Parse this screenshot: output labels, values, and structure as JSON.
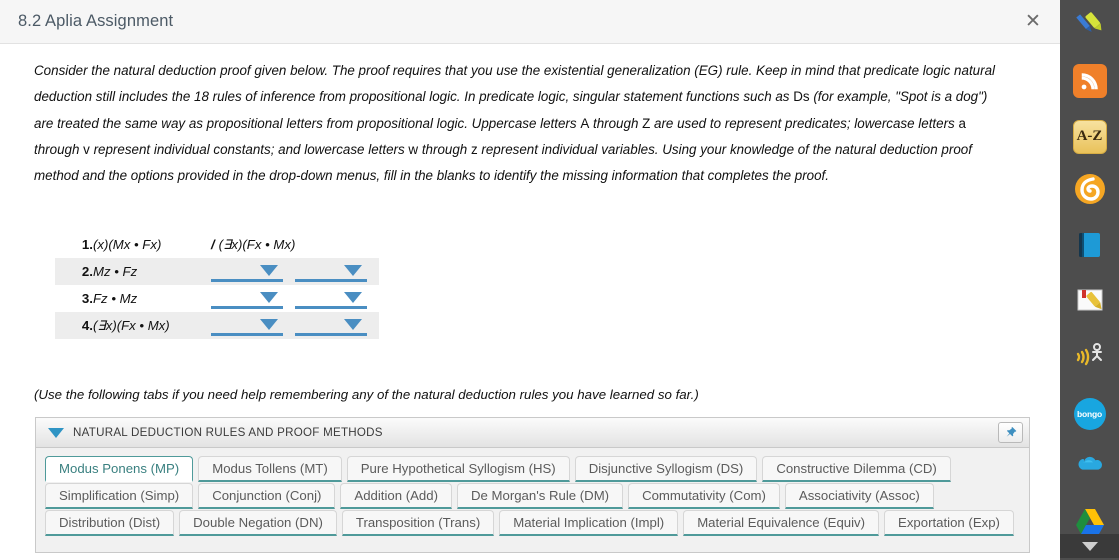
{
  "window": {
    "title": "8.2 Aplia Assignment",
    "close_label": "✕"
  },
  "intro": {
    "line1_a": "Consider the natural deduction proof given below. The proof requires that you use the existential generalization (EG) rule. Keep in mind that predicate",
    "line2_a": "logic natural deduction still includes the 18 rules of inference from propositional logic. In predicate logic, singular statement functions such as ",
    "line2_rm": "Ds",
    "line2_b": " (for",
    "line3_a": "example, \"Spot is a dog\") are treated the same way as propositional letters from propositional logic. Uppercase letters ",
    "line3_rm": "A",
    "line3_b": " through ",
    "line3_rm2": "Z",
    "line3_c": " are used to",
    "line4_a": "represent predicates; lowercase letters ",
    "line4_rm": "a",
    "line4_b": " through ",
    "line4_rm2": "v",
    "line4_c": " represent individual constants; and lowercase letters ",
    "line4_rm3": "w",
    "line4_d": " through ",
    "line4_rm4": "z",
    "line4_e": " represent individual variables.",
    "line5_a": "Using your knowledge of the natural deduction proof method and the options provided in the drop-down menus, fill in the blanks to identify the",
    "line6_a": "missing information that completes the proof."
  },
  "proof": {
    "rows": [
      {
        "num": "1.",
        "wff": "(x)(Mx • Fx)",
        "conclusion_slash": "/",
        "conclusion": "(∃x)(Fx • Mx)",
        "has_dropdowns": false
      },
      {
        "num": "2.",
        "wff": "Mz • Fz",
        "conclusion_slash": "",
        "conclusion": "",
        "has_dropdowns": true
      },
      {
        "num": "3.",
        "wff": "Fz • Mz",
        "conclusion_slash": "",
        "conclusion": "",
        "has_dropdowns": true
      },
      {
        "num": "4.",
        "wff": "(∃x)(Fx • Mx)",
        "conclusion_slash": "",
        "conclusion": "",
        "has_dropdowns": true
      }
    ]
  },
  "hint": {
    "text": "(Use the following tabs if you need help remembering any of the natural deduction rules you have learned so far.)"
  },
  "panel": {
    "header_label": "NATURAL DEDUCTION RULES AND PROOF METHODS",
    "caret_icon": "caret-down-icon",
    "pin_icon": "📌",
    "tab_rows": [
      [
        {
          "label": "Modus Ponens (MP)",
          "active": true
        },
        {
          "label": "Modus Tollens (MT)",
          "active": false
        },
        {
          "label": "Pure Hypothetical Syllogism (HS)",
          "active": false
        },
        {
          "label": "Disjunctive Syllogism (DS)",
          "active": false
        },
        {
          "label": "Constructive Dilemma (CD)",
          "active": false
        }
      ],
      [
        {
          "label": "Simplification (Simp)",
          "active": false
        },
        {
          "label": "Conjunction (Conj)",
          "active": false
        },
        {
          "label": "Addition (Add)",
          "active": false
        },
        {
          "label": "De Morgan's Rule (DM)",
          "active": false
        },
        {
          "label": "Commutativity (Com)",
          "active": false
        },
        {
          "label": "Associativity (Assoc)",
          "active": false
        }
      ],
      [
        {
          "label": "Distribution (Dist)",
          "active": false
        },
        {
          "label": "Double Negation (DN)",
          "active": false
        },
        {
          "label": "Transposition (Trans)",
          "active": false
        },
        {
          "label": "Material Implication (Impl)",
          "active": false
        },
        {
          "label": "Material Equivalence (Equiv)",
          "active": false
        },
        {
          "label": "Exportation (Exp)",
          "active": false
        }
      ]
    ]
  },
  "sidebar": {
    "background": "#4d4d4d",
    "items": [
      {
        "name": "highlighter-pen-icon",
        "type": "pen"
      },
      {
        "name": "rss-feed-icon",
        "type": "rss",
        "color": "#f0802a"
      },
      {
        "name": "dictionary-az-icon",
        "type": "az",
        "label": "A-Z",
        "color": "#f2d071"
      },
      {
        "name": "blackboard-icon",
        "type": "swirl",
        "color": "#f5a623"
      },
      {
        "name": "ebook-icon",
        "type": "book",
        "color": "#1e9ad6"
      },
      {
        "name": "notes-highlight-icon",
        "type": "notes",
        "color": "#e8c23a"
      },
      {
        "name": "read-aloud-icon",
        "type": "speak",
        "color": "#e8b92a"
      },
      {
        "name": "bongo-icon",
        "type": "bongo",
        "label": "bongo",
        "color": "#18a6e0"
      },
      {
        "name": "onedrive-cloud-icon",
        "type": "cloud",
        "color": "#29a8e0"
      },
      {
        "name": "google-drive-icon",
        "type": "drive"
      }
    ],
    "chevron_icon": "chevron-down-icon"
  }
}
